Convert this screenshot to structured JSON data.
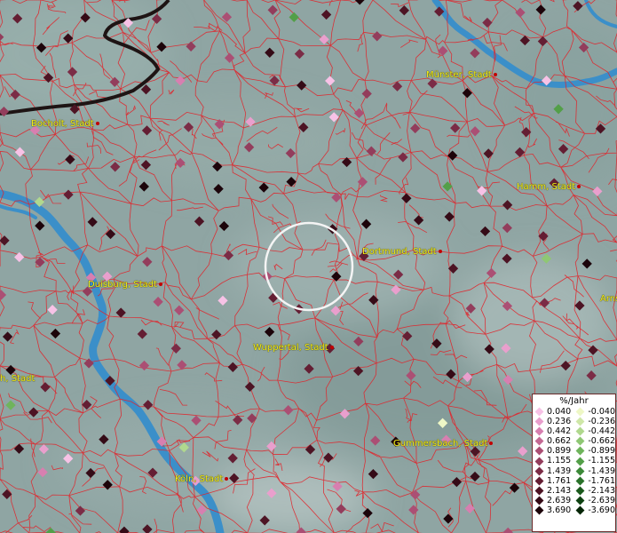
{
  "map": {
    "cities": [
      {
        "name": "Münster, Stadt"
      },
      {
        "name": "Bocholt, Stadt"
      },
      {
        "name": "Hamm, Stadt"
      },
      {
        "name": "Dortmund, Stadt"
      },
      {
        "name": "Duisburg, Stadt"
      },
      {
        "name": "Wuppertal, Stadt"
      },
      {
        "name": "Gummersbach, Stadt"
      },
      {
        "name": "Köln, Stadt"
      },
      {
        "name": "h, Stadt"
      },
      {
        "name": "Arns"
      }
    ],
    "colors": {
      "terrain": "#8fa5a3",
      "river": "#3b8fc9",
      "boundary": "#e0252b",
      "border": "#1e1414",
      "label": "#f2ec1a"
    }
  },
  "legend": {
    "title": "%/Jahr",
    "positive": [
      {
        "value": "0.040",
        "color": "#f7c2e6"
      },
      {
        "value": "0.236",
        "color": "#e99fcd"
      },
      {
        "value": "0.442",
        "color": "#d77fb0"
      },
      {
        "value": "0.662",
        "color": "#c46a94"
      },
      {
        "value": "0.899",
        "color": "#ab4f74"
      },
      {
        "value": "1.155",
        "color": "#933d5c"
      },
      {
        "value": "1.439",
        "color": "#7b2c46"
      },
      {
        "value": "1.761",
        "color": "#641e33"
      },
      {
        "value": "2.143",
        "color": "#4d1424"
      },
      {
        "value": "2.639",
        "color": "#350b17"
      },
      {
        "value": "3.690",
        "color": "#1c040a"
      }
    ],
    "negative": [
      {
        "value": "-0.040",
        "color": "#eef7c6"
      },
      {
        "value": "-0.236",
        "color": "#cfe7a8"
      },
      {
        "value": "-0.442",
        "color": "#b0d88e"
      },
      {
        "value": "-0.662",
        "color": "#8fc774"
      },
      {
        "value": "-0.899",
        "color": "#6fb45c"
      },
      {
        "value": "-1.155",
        "color": "#539f48"
      },
      {
        "value": "-1.439",
        "color": "#3c8938"
      },
      {
        "value": "-1.761",
        "color": "#2a722a"
      },
      {
        "value": "-2.143",
        "color": "#1b5a1d"
      },
      {
        "value": "-2.639",
        "color": "#0f4212"
      },
      {
        "value": "-3.690",
        "color": "#062607"
      }
    ]
  }
}
